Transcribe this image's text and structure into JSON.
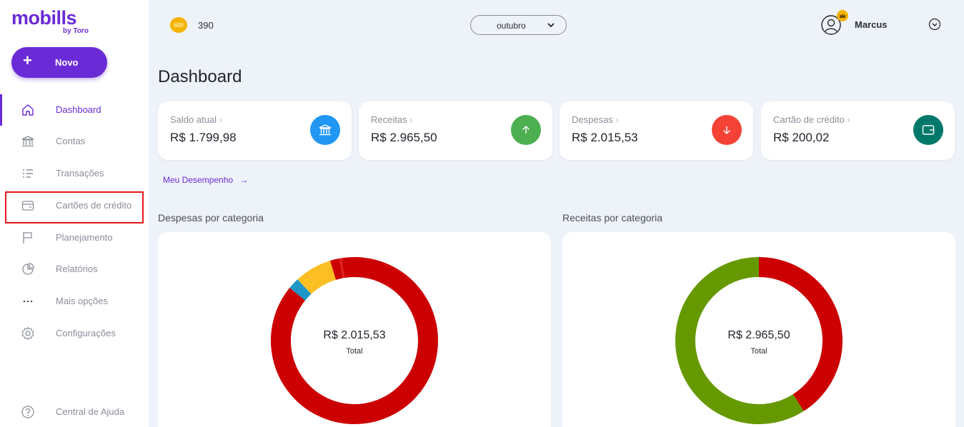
{
  "brand": {
    "name": "mobills",
    "sub": "by Toro"
  },
  "sidebar": {
    "new_button": "Novo",
    "items": [
      {
        "label": "Dashboard",
        "icon": "home-icon",
        "active": true
      },
      {
        "label": "Contas",
        "icon": "bank-icon"
      },
      {
        "label": "Transações",
        "icon": "list-icon"
      },
      {
        "label": "Cartões de crédito",
        "icon": "credit-card-icon",
        "highlighted": true
      },
      {
        "label": "Planejamento",
        "icon": "flag-icon"
      },
      {
        "label": "Relatórios",
        "icon": "pie-chart-icon"
      },
      {
        "label": "Mais opções",
        "icon": "more-icon"
      },
      {
        "label": "Configurações",
        "icon": "gear-icon"
      }
    ],
    "help": {
      "label": "Central de Ajuda",
      "icon": "help-icon"
    }
  },
  "header": {
    "points": "390",
    "month": "outubro",
    "user": "Marcus"
  },
  "page_title": "Dashboard",
  "cards": [
    {
      "label": "Saldo atual",
      "value": "R$ 1.799,98",
      "icon": "bank-icon",
      "color": "#2196f3"
    },
    {
      "label": "Receitas",
      "value": "R$ 2.965,50",
      "icon": "arrow-up-icon",
      "color": "#4caf50"
    },
    {
      "label": "Despesas",
      "value": "R$ 2.015,53",
      "icon": "arrow-down-icon",
      "color": "#f44336"
    },
    {
      "label": "Cartão de crédito",
      "value": "R$ 200,02",
      "icon": "wallet-icon",
      "color": "#00796b"
    }
  ],
  "performance_link": "Meu Desempenho",
  "colors": {
    "accent": "#6a2bd6"
  },
  "chart_data": [
    {
      "type": "pie",
      "title": "Despesas por categoria",
      "center_value": "R$ 2.015,53",
      "center_caption": "Total",
      "slices": [
        {
          "value": 85.9,
          "color": "#cc0000"
        },
        {
          "value": 2.2,
          "color": "#1e96c8"
        },
        {
          "value": 7.2,
          "color": "#fbbf24"
        },
        {
          "value": 1.8,
          "color": "#cc0000"
        },
        {
          "value": 0.4,
          "color": "#e02020"
        },
        {
          "value": 2.5,
          "color": "#cc0000"
        }
      ]
    },
    {
      "type": "pie",
      "title": "Receitas por categoria",
      "center_value": "R$ 2.965,50",
      "center_caption": "Total",
      "slices": [
        {
          "value": 41,
          "color": "#cc0000"
        },
        {
          "value": 59,
          "color": "#669900"
        }
      ]
    }
  ]
}
